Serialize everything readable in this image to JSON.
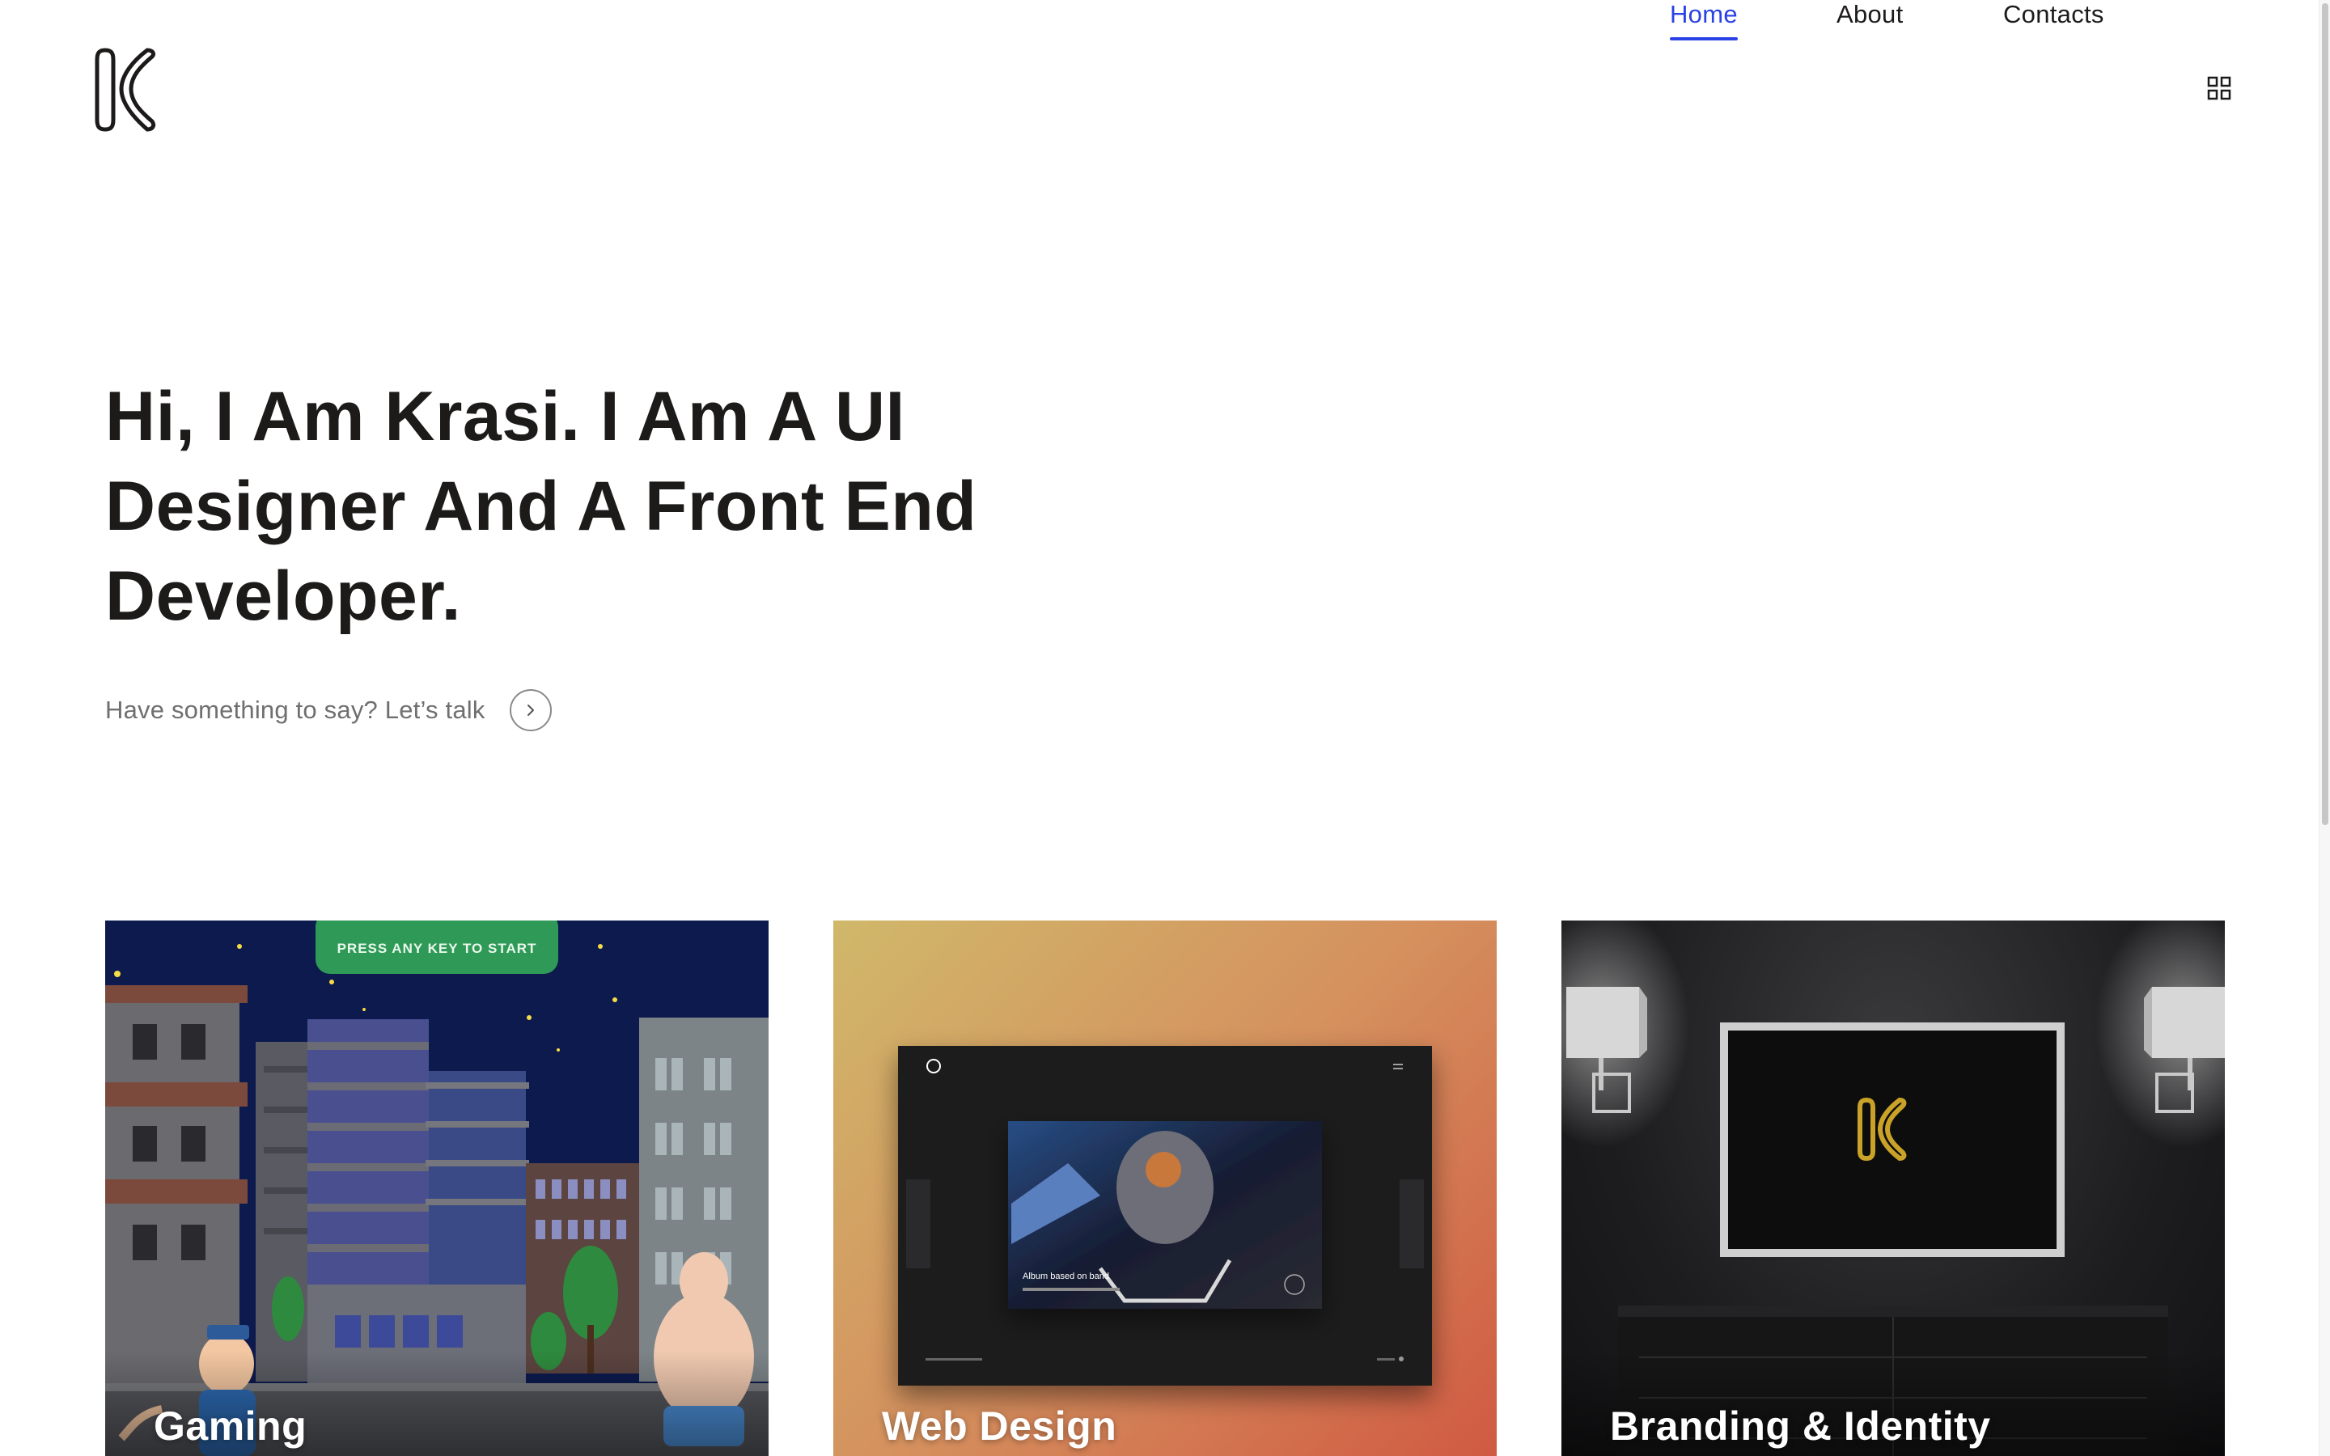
{
  "header": {
    "nav": [
      {
        "label": "Home",
        "active": true
      },
      {
        "label": "About",
        "active": false
      },
      {
        "label": "Contacts",
        "active": false
      }
    ],
    "grid_icon": "grid-icon",
    "accent_color": "#2a42e5"
  },
  "hero": {
    "title": "Hi, I Am Krasi. I Am A UI Designer And A Front End Developer.",
    "cta_text": "Have something to say? Let’s talk",
    "cta_icon": "chevron-right-icon"
  },
  "projects": [
    {
      "title": "Gaming",
      "banner": "PRESS ANY KEY TO START"
    },
    {
      "title": "Web Design",
      "mock_caption": "Album based on band"
    },
    {
      "title": "Branding & Identity"
    }
  ]
}
